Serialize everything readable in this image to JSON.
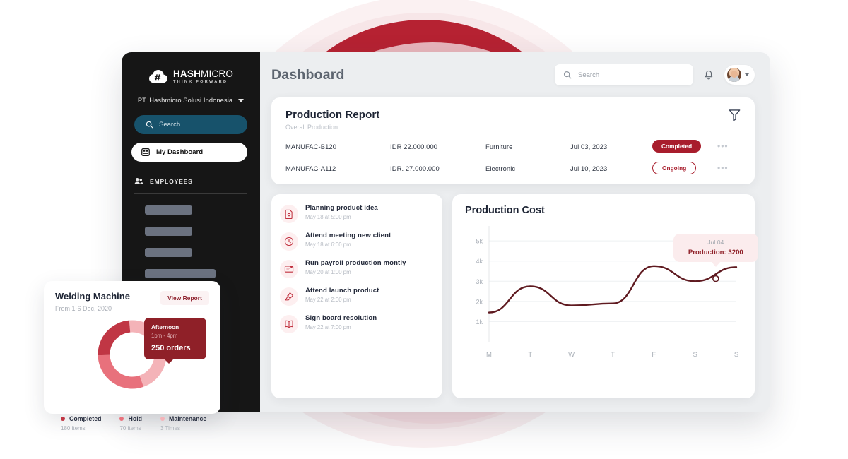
{
  "brand": {
    "name_bold": "HASH",
    "name_thin": "MICRO",
    "tagline": "THINK FORWARD",
    "logo_icon": "cloud-hash-icon"
  },
  "sidebar": {
    "company": "PT. Hashmicro Solusi Indonesia",
    "company_caret": "chevron-down-icon",
    "search_placeholder": "Search..",
    "search_icon": "search-icon",
    "active_item": {
      "label": "My Dashboard",
      "icon": "dashboard-icon"
    },
    "section": {
      "label": "EMPLOYEES",
      "icon": "employees-icon"
    },
    "placeholder_items": 4
  },
  "topbar": {
    "title": "Dashboard",
    "search_placeholder": "Search",
    "search_icon": "search-icon",
    "bell_icon": "bell-icon",
    "avatar": "user-avatar",
    "avatar_caret": "chevron-down-icon"
  },
  "report": {
    "title": "Production Report",
    "subtitle": "Overall Production",
    "filter_icon": "filter-icon",
    "more_icon": "more-options-icon",
    "rows": [
      {
        "code": "MANUFAC-B120",
        "amount": "IDR 22.000.000",
        "category": "Furniture",
        "date": "Jul 03, 2023",
        "status": "Completed",
        "status_type": "completed"
      },
      {
        "code": "MANUFAC-A112",
        "amount": "IDR. 27.000.000",
        "category": "Electronic",
        "date": "Jul 10, 2023",
        "status": "Ongoing",
        "status_type": "ongoing"
      }
    ]
  },
  "tasks": [
    {
      "title": "Planning product idea",
      "time": "May 18 at 5:00 pm",
      "icon": "file-document-icon"
    },
    {
      "title": "Attend meeting new client",
      "time": "May 18 at 6:00 pm",
      "icon": "clock-icon"
    },
    {
      "title": "Run payroll production montly",
      "time": "May 20 at 1:00 pm",
      "icon": "payroll-card-icon"
    },
    {
      "title": "Attend launch product",
      "time": "May 22 at 2:00 pm",
      "icon": "eraser-icon"
    },
    {
      "title": "Sign board resolution",
      "time": "May 22 at 7:00 pm",
      "icon": "open-book-icon"
    }
  ],
  "welding": {
    "title": "Welding Machine",
    "subtitle": "From 1-6 Dec, 2020",
    "view_report_label": "View Report",
    "tooltip": {
      "title": "Afternoon",
      "range": "1pm - 4pm",
      "value": "250 orders"
    },
    "legend": [
      {
        "label": "Completed",
        "value": "180 items",
        "color": "#c03644"
      },
      {
        "label": "Hold",
        "value": "70 items",
        "color": "#e8717c"
      },
      {
        "label": "Maintenance",
        "value": "3 Times",
        "color": "#f4b3b8"
      }
    ]
  },
  "colors": {
    "brand_red": "#a81d2c",
    "deep_red": "#8f2028",
    "line_red": "#5f1a20",
    "sidebar_bg": "#161616",
    "sidebar_search": "#17526b",
    "app_bg": "#eceef0",
    "bg_circle": "#b62232",
    "bg_pink": "#f4dadd"
  },
  "chart_data": {
    "type": "line",
    "title": "Production Cost",
    "xlabel": "",
    "ylabel": "",
    "categories": [
      "M",
      "T",
      "W",
      "T",
      "F",
      "S",
      "S"
    ],
    "tick_labels": [
      "1k",
      "2k",
      "3k",
      "4k",
      "5k"
    ],
    "tick_values": [
      1000,
      2000,
      3000,
      4000,
      5000
    ],
    "ylim": [
      0,
      5600
    ],
    "grid": true,
    "legend": "none",
    "series": [
      {
        "name": "Production",
        "color": "#5f1a20",
        "values": [
          1450,
          2750,
          1800,
          1900,
          3750,
          3000,
          3700
        ]
      }
    ],
    "annotation": {
      "label": "Jul 04",
      "value_label": "Production: 3200",
      "value": 3200,
      "point_x_category": "S",
      "marker": "hollow-circle"
    }
  },
  "donut_data": {
    "type": "pie",
    "segments": [
      {
        "label": "Maintenance",
        "color": "#f4b3b8",
        "percent": 46
      },
      {
        "label": "Hold",
        "color": "#e8717c",
        "percent": 30
      },
      {
        "label": "Completed",
        "color": "#c03644",
        "percent": 24
      }
    ]
  }
}
